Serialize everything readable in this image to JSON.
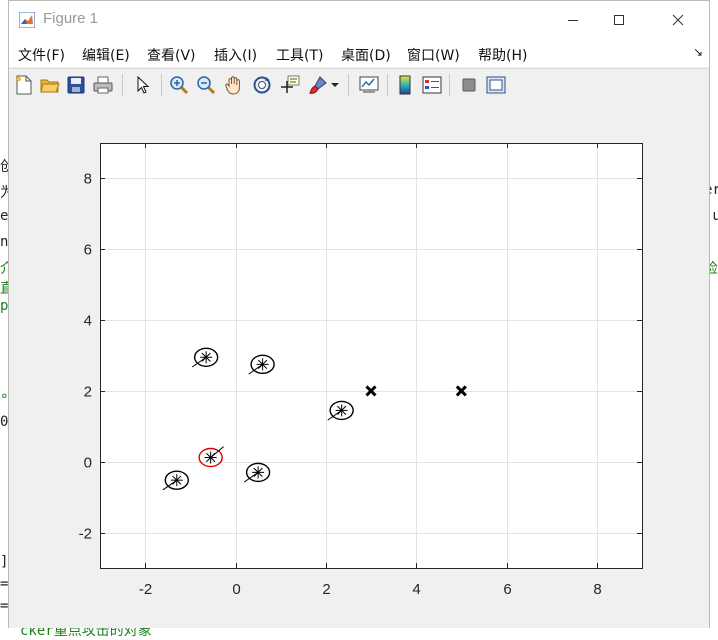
{
  "window": {
    "title": "Figure 1",
    "menu": [
      "文件(F)",
      "编辑(E)",
      "查看(V)",
      "插入(I)",
      "工具(T)",
      "桌面(D)",
      "窗口(W)",
      "帮助(H)"
    ],
    "dock_glyph": "↘"
  },
  "toolbar": {
    "buttons": [
      "new-figure",
      "open-file",
      "save-figure",
      "print-figure",
      "edit-plot",
      "zoom-in",
      "zoom-out",
      "pan",
      "rotate-3d",
      "data-cursor",
      "brush",
      "brush-dropdown",
      "link-plot",
      "insert-colorbar",
      "insert-legend",
      "hide-plot-tools",
      "show-plot-tools"
    ]
  },
  "background_editor": {
    "left_fragments": [
      "创",
      "为",
      "et",
      "nt",
      "介",
      "直",
      "p-",
      "°",
      "0",
      "];",
      "=",
      "="
    ],
    "right_fragments": [
      "检",
      "er",
      ".u",
      "cker重点攻击的对象"
    ]
  },
  "chart_data": {
    "type": "scatter",
    "xlim": [
      -3,
      9
    ],
    "ylim": [
      -3,
      9
    ],
    "xticks": [
      "-2",
      "0",
      "2",
      "4",
      "6",
      "8"
    ],
    "yticks": [
      "-2",
      "0",
      "2",
      "4",
      "6",
      "8"
    ],
    "grid": true,
    "agents": [
      {
        "x": -0.65,
        "y": 2.95,
        "heading_deg": 215,
        "color": "#000000"
      },
      {
        "x": 0.6,
        "y": 2.75,
        "heading_deg": 215,
        "color": "#000000"
      },
      {
        "x": 2.35,
        "y": 1.45,
        "heading_deg": 215,
        "color": "#000000"
      },
      {
        "x": -0.55,
        "y": 0.12,
        "heading_deg": 40,
        "color": "#e00000"
      },
      {
        "x": -1.3,
        "y": -0.52,
        "heading_deg": 215,
        "color": "#000000"
      },
      {
        "x": 0.5,
        "y": -0.3,
        "heading_deg": 215,
        "color": "#000000"
      }
    ],
    "targets": [
      {
        "x": 3.0,
        "y": 2.0
      },
      {
        "x": 5.0,
        "y": 2.0
      }
    ]
  }
}
